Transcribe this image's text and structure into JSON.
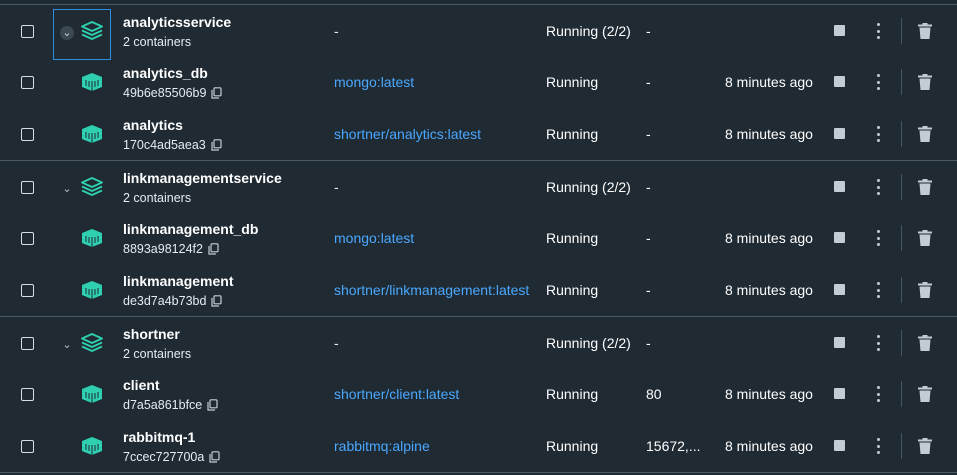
{
  "colors": {
    "background": "#1f2a33",
    "link": "#4aa8ff",
    "icon_teal": "#2fd0b0",
    "separator": "#4a5a66"
  },
  "rows": [
    {
      "type": "group",
      "name": "analyticsservice",
      "sub": "2 containers",
      "image": "-",
      "status": "Running (2/2)",
      "port": "-",
      "created": "",
      "focused": true
    },
    {
      "type": "container",
      "name": "analytics_db",
      "sub": "49b6e85506b9",
      "image": "mongo:latest",
      "status": "Running",
      "port": "-",
      "created": "8 minutes ago"
    },
    {
      "type": "container",
      "name": "analytics",
      "sub": "170c4ad5aea3",
      "image": "shortner/analytics:latest",
      "status": "Running",
      "port": "-",
      "created": "8 minutes ago"
    },
    {
      "type": "group",
      "name": "linkmanagementservice",
      "sub": "2 containers",
      "image": "-",
      "status": "Running (2/2)",
      "port": "-",
      "created": ""
    },
    {
      "type": "container",
      "name": "linkmanagement_db",
      "sub": "8893a98124f2",
      "image": "mongo:latest",
      "status": "Running",
      "port": "-",
      "created": "8 minutes ago"
    },
    {
      "type": "container",
      "name": "linkmanagement",
      "sub": "de3d7a4b73bd",
      "image": "shortner/linkmanagement:latest",
      "status": "Running",
      "port": "-",
      "created": "8 minutes ago"
    },
    {
      "type": "group",
      "name": "shortner",
      "sub": "2 containers",
      "image": "-",
      "status": "Running (2/2)",
      "port": "-",
      "created": ""
    },
    {
      "type": "container",
      "name": "client",
      "sub": "d7a5a861bfce",
      "image": "shortner/client:latest",
      "status": "Running",
      "port": "80",
      "created": "8 minutes ago"
    },
    {
      "type": "container",
      "name": "rabbitmq-1",
      "sub": "7ccec727700a",
      "image": "rabbitmq:alpine",
      "status": "Running",
      "port": "15672,...",
      "created": "8 minutes ago"
    }
  ]
}
